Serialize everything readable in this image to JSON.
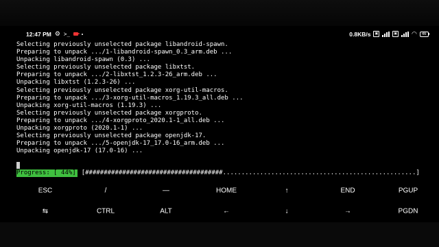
{
  "status_bar": {
    "time": "12:47 PM",
    "gear_icon": "⚙",
    "terminal_icon": "≻_",
    "net_speed": "0.8KB/s",
    "battery": "46"
  },
  "terminal": {
    "lines": [
      "Selecting previously unselected package libandroid-spawn.",
      "Preparing to unpack .../1-libandroid-spawn_0.3_arm.deb ...",
      "Unpacking libandroid-spawn (0.3) ...",
      "Selecting previously unselected package libxtst.",
      "Preparing to unpack .../2-libxtst_1.2.3-26_arm.deb ...",
      "Unpacking libxtst (1.2.3-26) ...",
      "Selecting previously unselected package xorg-util-macros.",
      "Preparing to unpack .../3-xorg-util-macros_1.19.3_all.deb ...",
      "Unpacking xorg-util-macros (1.19.3) ...",
      "Selecting previously unselected package xorgproto.",
      "Preparing to unpack .../4-xorgproto_2020.1-1_all.deb ...",
      "Unpacking xorgproto (2020.1-1) ...",
      "Selecting previously unselected package openjdk-17.",
      "Preparing to unpack .../5-openjdk-17_17.0-16_arm.deb ...",
      "Unpacking openjdk-17 (17.0-16) ..."
    ],
    "progress_label": "Progress: [ 44%]",
    "progress_bar": "[#####################################....................................................]",
    "progress_percent": 44
  },
  "extra_keys": {
    "row1": [
      "ESC",
      "/",
      "—",
      "HOME",
      "↑",
      "END",
      "PGUP"
    ],
    "row2": [
      "⇆",
      "CTRL",
      "ALT",
      "←",
      "↓",
      "→",
      "PGDN"
    ]
  }
}
